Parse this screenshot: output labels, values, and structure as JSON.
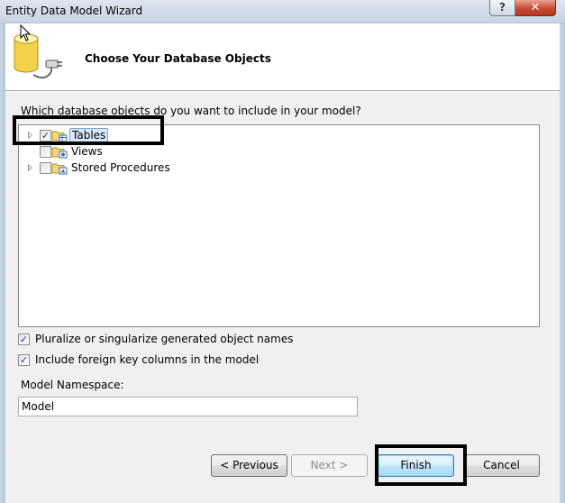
{
  "window": {
    "title": "Entity Data Model Wizard",
    "help_label": "?",
    "close_label": "✕"
  },
  "header": {
    "title": "Choose Your Database Objects"
  },
  "main": {
    "question": "Which database objects do you want to include in your model?",
    "tree": [
      {
        "label": "Tables",
        "checked": true,
        "expandable": true,
        "selected": true
      },
      {
        "label": "Views",
        "checked": false,
        "expandable": false,
        "selected": false
      },
      {
        "label": "Stored Procedures",
        "checked": false,
        "expandable": true,
        "selected": false
      }
    ],
    "options": [
      {
        "label": "Pluralize or singularize generated object names",
        "checked": true
      },
      {
        "label": "Include foreign key columns in the model",
        "checked": true
      }
    ],
    "namespace": {
      "label": "Model Namespace:",
      "value": "Model"
    }
  },
  "buttons": {
    "previous": "< Previous",
    "next": "Next >",
    "finish": "Finish",
    "cancel": "Cancel"
  },
  "icons": {
    "checkmark": "✓"
  }
}
